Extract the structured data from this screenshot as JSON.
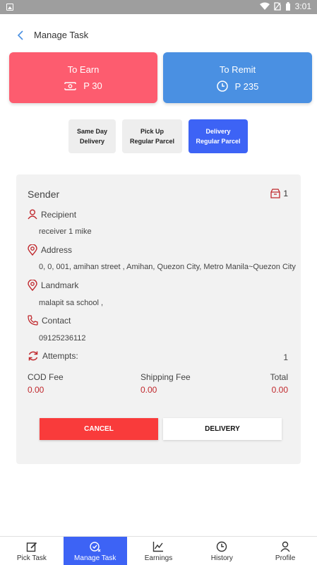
{
  "status_bar": {
    "time": "3:01"
  },
  "header": {
    "title": "Manage Task"
  },
  "earn": {
    "label": "To Earn",
    "value": "P 30"
  },
  "remit": {
    "label": "To Remit",
    "value": "P 235"
  },
  "tabs": [
    {
      "label": "Same Day\nDelivery",
      "active": false
    },
    {
      "label": "Pick Up\nRegular Parcel",
      "active": false
    },
    {
      "label": "Delivery\nRegular Parcel",
      "active": true
    }
  ],
  "card": {
    "sender_label": "Sender",
    "package_count": "1",
    "recipient_label": "Recipient",
    "recipient_value": "receiver 1 mike",
    "address_label": "Address",
    "address_value": "0, 0, 001, amihan street , Amihan, Quezon City, Metro Manila~Quezon City",
    "landmark_label": "Landmark",
    "landmark_value": "malapit sa school ,",
    "contact_label": "Contact",
    "contact_value": "09125236112",
    "attempts_label": "Attempts:",
    "attempts_value": "1",
    "cod_label": "COD Fee",
    "cod_value": "0.00",
    "shipping_label": "Shipping Fee",
    "shipping_value": "0.00",
    "total_label": "Total",
    "total_value": "0.00",
    "cancel_label": "CANCEL",
    "delivery_label": "DELIVERY"
  },
  "nav": [
    {
      "label": "Pick Task",
      "icon": "edit-icon"
    },
    {
      "label": "Manage Task",
      "icon": "task-check-icon"
    },
    {
      "label": "Earnings",
      "icon": "chart-icon"
    },
    {
      "label": "History",
      "icon": "clock-icon"
    },
    {
      "label": "Profile",
      "icon": "user-icon"
    }
  ],
  "colors": {
    "earn": "#fd5c6f",
    "remit": "#4a90e2",
    "active_tab": "#3d63f5",
    "cancel": "#f93b3b",
    "accent_red": "#c0282d"
  }
}
